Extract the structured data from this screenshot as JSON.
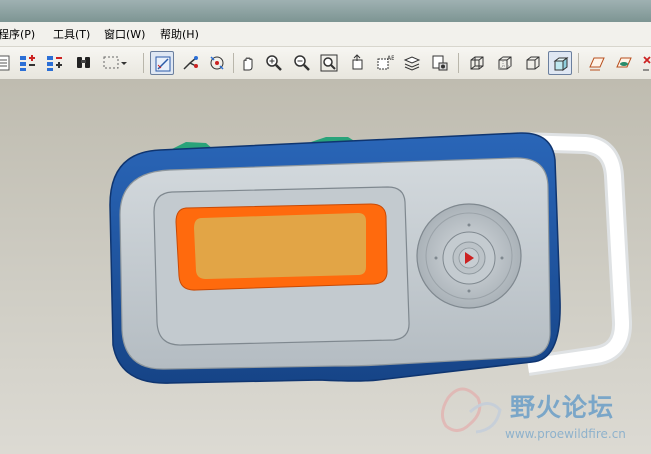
{
  "menu": {
    "items": [
      {
        "label": "程序(P)"
      },
      {
        "label": "工具(T)"
      },
      {
        "label": "窗口(W)"
      },
      {
        "label": "帮助(H)"
      }
    ]
  },
  "toolbar": {
    "buttons": [
      {
        "icon": "model-tree-icon"
      },
      {
        "icon": "layer-up-icon"
      },
      {
        "icon": "layer-down-icon"
      },
      {
        "icon": "binoculars-icon"
      },
      {
        "icon": "selection-box-icon"
      },
      {
        "icon": "sketch-view-icon"
      },
      {
        "icon": "datum-axis-icon"
      },
      {
        "icon": "spin-center-icon"
      },
      {
        "icon": "pan-hand-icon"
      },
      {
        "icon": "zoom-in-icon"
      },
      {
        "icon": "zoom-out-icon"
      },
      {
        "icon": "refit-icon"
      },
      {
        "icon": "reorient-icon"
      },
      {
        "icon": "saved-views-icon"
      },
      {
        "icon": "layers-icon"
      },
      {
        "icon": "view-manager-icon"
      },
      {
        "icon": "wireframe-icon"
      },
      {
        "icon": "hidden-line-icon"
      },
      {
        "icon": "no-hidden-icon"
      },
      {
        "icon": "shading-icon"
      },
      {
        "icon": "datum-plane-icon"
      },
      {
        "icon": "datum-plane-display-icon"
      },
      {
        "icon": "close-icon"
      }
    ],
    "active_button": "shading-icon"
  },
  "watermark": {
    "title": "野火论坛",
    "url": "www.proewildfire.cn"
  },
  "colors": {
    "device_body": "#1f57a8",
    "device_face": "#c6ced3",
    "screen_orange": "#ff6a0d",
    "screen_inner": "#e2a546",
    "play_button": "#cc2222",
    "handle": "#ffffff",
    "accent_green": "#29a37a"
  }
}
